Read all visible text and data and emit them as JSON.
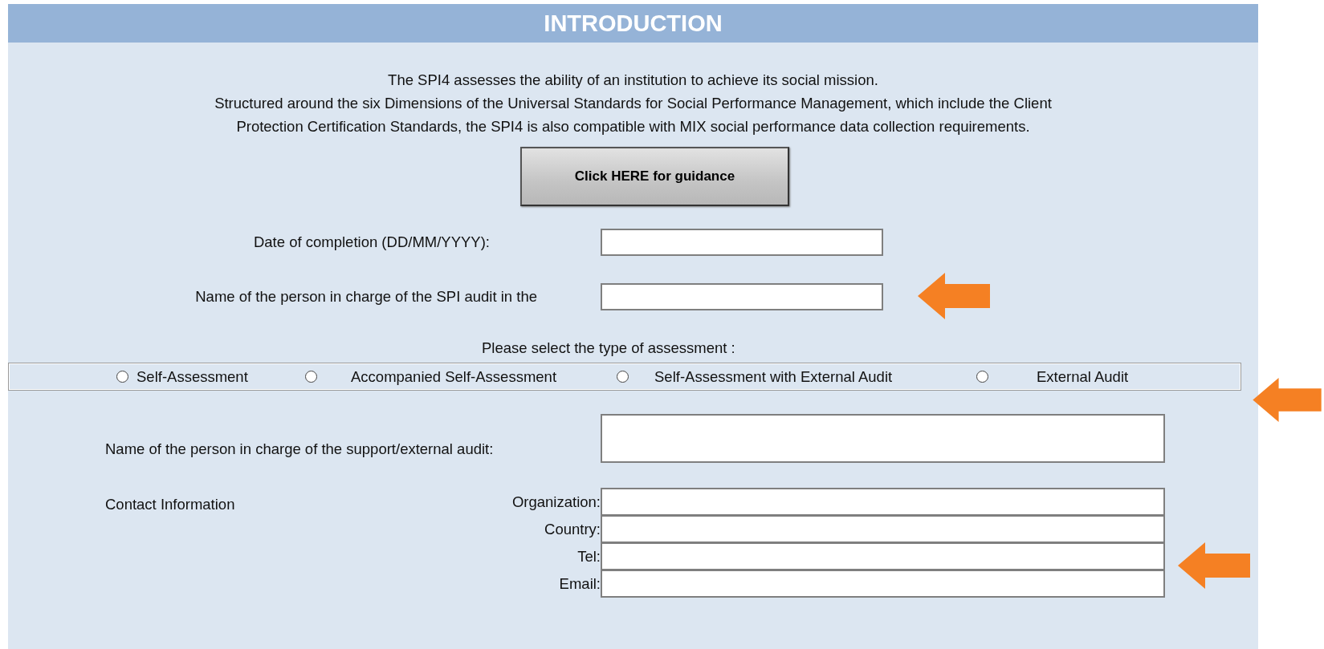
{
  "header": {
    "title": "INTRODUCTION"
  },
  "intro": [
    "The SPI4 assesses the ability of an institution to achieve its social mission.",
    "Structured around the six Dimensions of the Universal Standards for Social Performance Management, which include the Client Protection Certification Standards, the SPI4 is also compatible with MIX social performance data collection requirements."
  ],
  "guidance_button": {
    "label": "Click HERE  for guidance"
  },
  "fields": [
    {
      "label": "Date of completion (DD/MM/YYYY):"
    },
    {
      "label": "Name of the person in charge of the SPI audit in the"
    }
  ],
  "assessment": {
    "prompt": "Please select the type of assessment :",
    "options": [
      {
        "label": "Self-Assessment",
        "selected": false
      },
      {
        "label": "Accompanied Self-Assessment",
        "selected": false
      },
      {
        "label": "Self-Assessment with External Audit",
        "selected": false
      },
      {
        "label": "External Audit",
        "selected": false
      }
    ]
  },
  "support": {
    "label": "Name of the person in charge of the support/external audit:"
  },
  "contact": {
    "label": "Contact Information",
    "fields": [
      {
        "label": "Organization:"
      },
      {
        "label": "Country:"
      },
      {
        "label": "Tel:"
      },
      {
        "label": "Email:"
      }
    ]
  }
}
